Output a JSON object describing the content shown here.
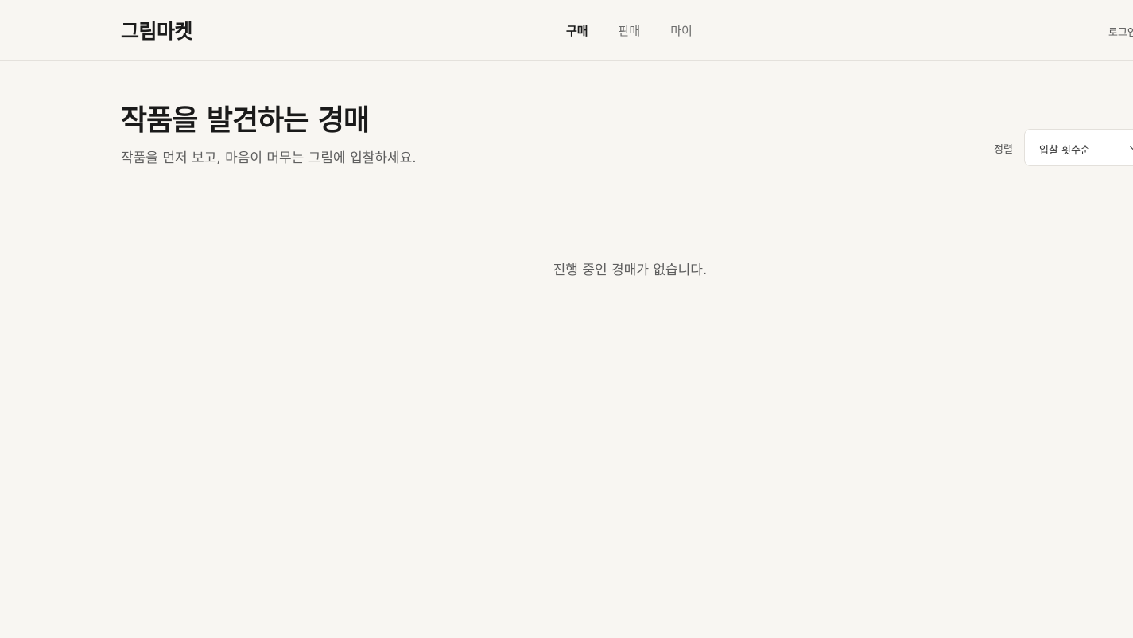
{
  "header": {
    "logo": "그림마켓",
    "nav": [
      {
        "label": "구매",
        "active": true
      },
      {
        "label": "판매",
        "active": false
      },
      {
        "label": "마이",
        "active": false
      }
    ],
    "login_label": "로그인"
  },
  "main": {
    "title": "작품을 발견하는 경매",
    "subtitle": "작품을 먼저 보고, 마음이 머무는 그림에 입찰하세요.",
    "sort": {
      "label": "정렬",
      "selected": "입찰 횟수순"
    },
    "empty_message": "진행 중인 경매가 없습니다."
  },
  "icons": {
    "sort_chevron": "chevron-down-icon"
  },
  "colors": {
    "background": "#f8f6f2",
    "text_primary": "#1a1a1a",
    "text_secondary": "#5e5e5e",
    "border": "#e4e1dc"
  }
}
